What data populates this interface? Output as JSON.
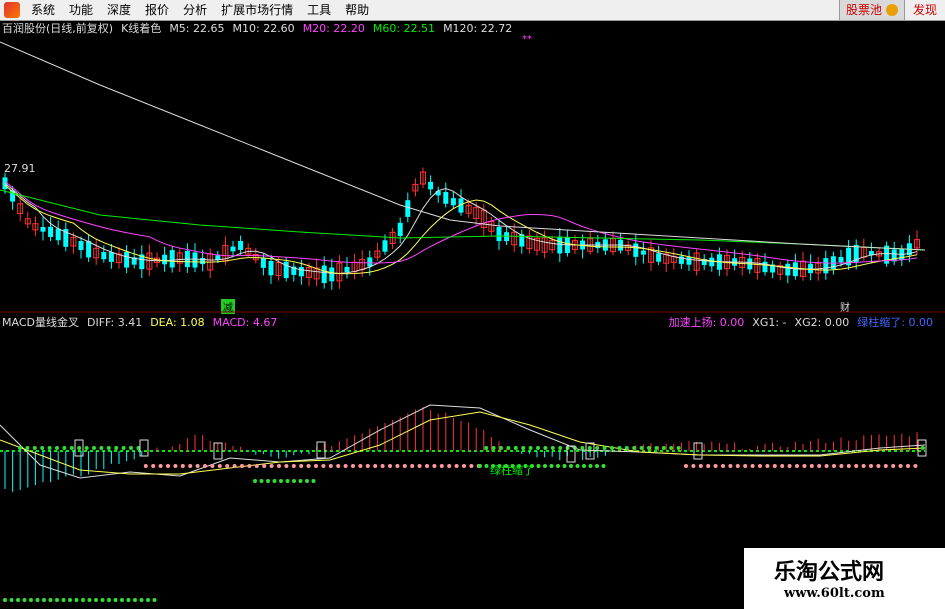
{
  "menu": {
    "items": [
      "系统",
      "功能",
      "深度",
      "报价",
      "分析",
      "扩展市场行情",
      "工具",
      "帮助"
    ],
    "pick_stock": "股票池",
    "alert": "发现"
  },
  "kline": {
    "title": "百润股份(日线,前复权)",
    "mode": "K线着色",
    "ma": [
      {
        "label": "M5: 22.65",
        "color": "#dddddd"
      },
      {
        "label": "M10: 22.60",
        "color": "#ffff55"
      },
      {
        "label": "M20: 22.20",
        "color": "#ff44ff"
      },
      {
        "label": "M60: 22.51",
        "color": "#00ee00"
      },
      {
        "label": "M120: 22.72",
        "color": "#dddddd"
      }
    ],
    "high_label": "27.91",
    "markers": {
      "jian": "减",
      "fin": "财"
    }
  },
  "macd": {
    "title": "MACD量线金叉",
    "diff": "DIFF: 3.41",
    "dea": "DEA: 1.08",
    "macd": "MACD: 4.67",
    "signals": {
      "accel": "加速上扬: 0.00",
      "xg1": "XG1: -",
      "xg2": "XG2: 0.00",
      "green_short": "绿柱缩了: 0.00"
    },
    "annotation": "绿柱缩了"
  },
  "watermark": {
    "name": "乐淘公式网",
    "url": "www.60lt.com"
  },
  "colors": {
    "up": "#ff3333",
    "down": "#00ffff",
    "ma5": "#dddddd",
    "ma10": "#ffff55",
    "ma20": "#ff44ff",
    "ma60": "#00ee00",
    "ma120": "#dddddd"
  }
}
